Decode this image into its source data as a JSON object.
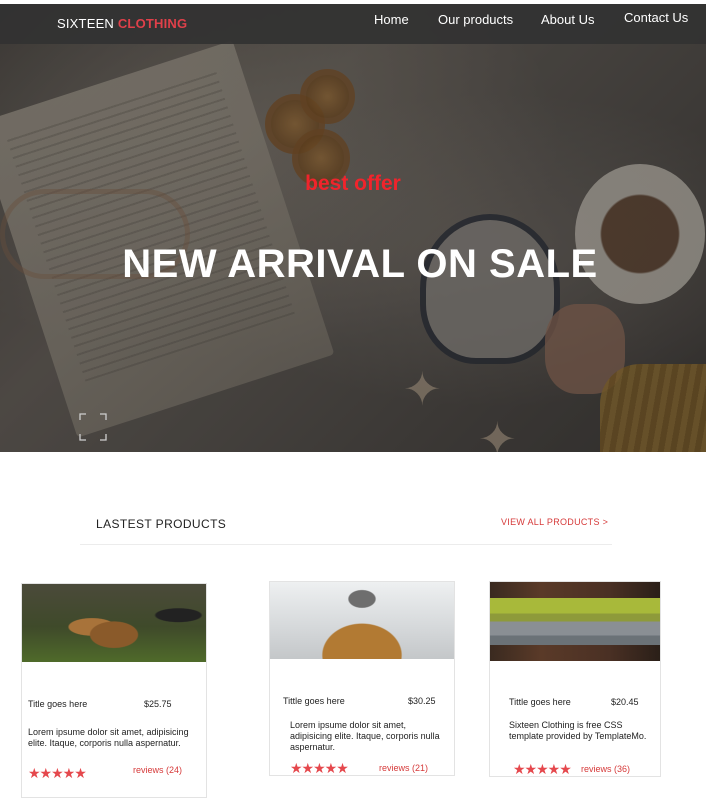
{
  "nav": {
    "logo_primary": "SIXTEEN",
    "logo_accent": "CLOTHING",
    "links": [
      "Home",
      "Our products",
      "About Us",
      "Contact Us"
    ]
  },
  "hero": {
    "subtitle": "best offer",
    "title": "NEW ARRIVAL ON SALE"
  },
  "latest": {
    "title": "LASTEST PRODUCTS",
    "view_all": "VIEW ALL PRODUCTS >"
  },
  "products": [
    {
      "image": "hiking-boots",
      "title": "Title goes  here",
      "price": "$25.75",
      "description": "Lorem ipsume dolor sit amet, adipisicing elite. Itaque, corporis nulla aspernatur.",
      "rating": 5,
      "stars": "★★★★★",
      "reviews": "reviews (24)"
    },
    {
      "image": "person-in-beanie",
      "title": "Tittle goes here",
      "price": "$30.25",
      "description": "Lorem ipsume dolor sit amet, adipisicing elite. Itaque, corporis nulla aspernatur.",
      "rating": 5,
      "stars": "★★★★★",
      "reviews": "reviews (21)"
    },
    {
      "image": "folded-scarves",
      "title": "Tittle goes here",
      "price": "$20.45",
      "description": "Sixteen Clothing is free CSS template provided by TemplateMo.",
      "rating": 5,
      "stars": "★★★★★",
      "reviews": "reviews (36)"
    }
  ],
  "colors": {
    "accent": "#e0404a",
    "hero_subtitle": "#f0242c",
    "stars": "#e5484d",
    "nav_bg": "#323232"
  },
  "icons": {
    "hero_corner": "focus-frame-icon"
  }
}
